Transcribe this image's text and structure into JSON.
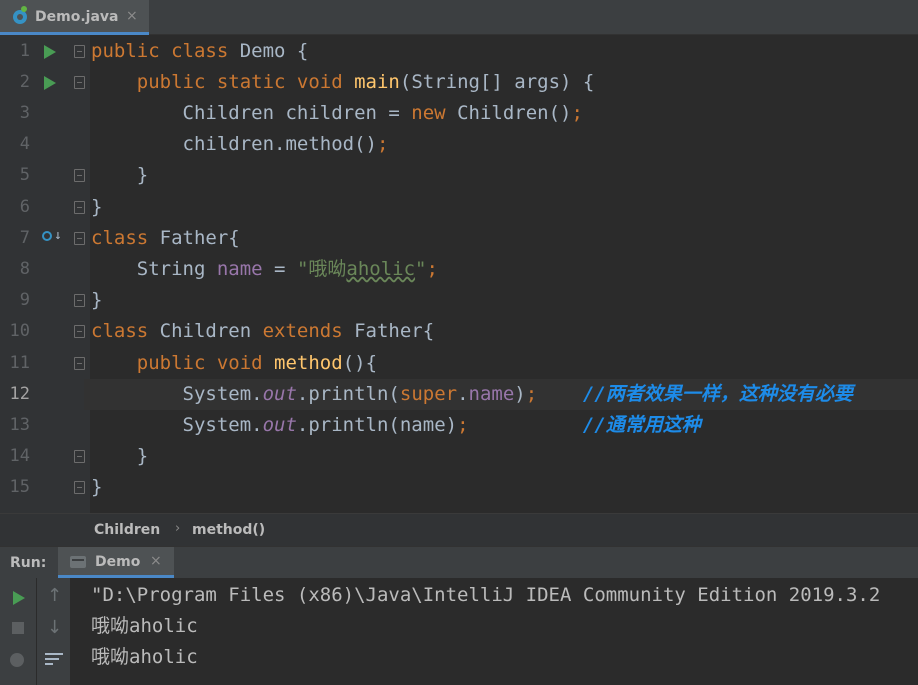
{
  "tab": {
    "label": "Demo.java",
    "close": "×",
    "icon": "java-class-icon"
  },
  "editor": {
    "caret_line": 12,
    "lines": [
      {
        "n": "1",
        "marker": "run",
        "fold": true,
        "tokens": [
          [
            "kw",
            "public "
          ],
          [
            "kw",
            "class "
          ],
          [
            "",
            "Demo {"
          ]
        ]
      },
      {
        "n": "2",
        "marker": "run",
        "fold": true,
        "tokens": [
          [
            "",
            "    "
          ],
          [
            "kw",
            "public static void "
          ],
          [
            "fn",
            "main"
          ],
          [
            "",
            "(String[] args) {"
          ]
        ]
      },
      {
        "n": "3",
        "marker": "",
        "fold": false,
        "tokens": [
          [
            "",
            "        Children children = "
          ],
          [
            "kw",
            "new "
          ],
          [
            "",
            "Children()"
          ],
          [
            "kw",
            ";"
          ]
        ]
      },
      {
        "n": "4",
        "marker": "",
        "fold": false,
        "tokens": [
          [
            "",
            "        children.method()"
          ],
          [
            "kw",
            ";"
          ]
        ]
      },
      {
        "n": "5",
        "marker": "",
        "fold": true,
        "tokens": [
          [
            "",
            "    }"
          ]
        ]
      },
      {
        "n": "6",
        "marker": "",
        "fold": true,
        "tokens": [
          [
            "",
            "}"
          ]
        ]
      },
      {
        "n": "7",
        "marker": "impl",
        "fold": true,
        "tokens": [
          [
            "kw",
            "class "
          ],
          [
            "",
            "Father{"
          ]
        ]
      },
      {
        "n": "8",
        "marker": "",
        "fold": false,
        "tokens": [
          [
            "",
            "    String "
          ],
          [
            "fld",
            "name"
          ],
          [
            "",
            " = "
          ],
          [
            "str",
            "\"哦呦"
          ],
          [
            "str typo",
            "aholic"
          ],
          [
            "str",
            "\""
          ],
          [
            "kw",
            ";"
          ]
        ]
      },
      {
        "n": "9",
        "marker": "",
        "fold": true,
        "tokens": [
          [
            "",
            "}"
          ]
        ]
      },
      {
        "n": "10",
        "marker": "",
        "fold": true,
        "tokens": [
          [
            "kw",
            "class "
          ],
          [
            "",
            "Children "
          ],
          [
            "kw",
            "extends "
          ],
          [
            "",
            "Father{"
          ]
        ]
      },
      {
        "n": "11",
        "marker": "",
        "fold": true,
        "tokens": [
          [
            "",
            "    "
          ],
          [
            "kw",
            "public void "
          ],
          [
            "fn",
            "method"
          ],
          [
            "",
            "(){"
          ]
        ]
      },
      {
        "n": "12",
        "marker": "",
        "fold": false,
        "tokens": [
          [
            "",
            "        System."
          ],
          [
            "sfld",
            "out"
          ],
          [
            "",
            ".println("
          ],
          [
            "kw",
            "super"
          ],
          [
            "",
            "."
          ],
          [
            "fld",
            "name"
          ],
          [
            "",
            ")"
          ],
          [
            "kw",
            ";"
          ],
          [
            "",
            "    "
          ],
          [
            "cmt",
            "//两者效果一样，这种没有必要"
          ]
        ]
      },
      {
        "n": "13",
        "marker": "",
        "fold": false,
        "tokens": [
          [
            "",
            "        System."
          ],
          [
            "sfld",
            "out"
          ],
          [
            "",
            ".println(name)"
          ],
          [
            "kw",
            ";"
          ],
          [
            "",
            "          "
          ],
          [
            "cmt",
            "//通常用这种"
          ]
        ]
      },
      {
        "n": "14",
        "marker": "",
        "fold": true,
        "tokens": [
          [
            "",
            "    }"
          ]
        ]
      },
      {
        "n": "15",
        "marker": "",
        "fold": true,
        "tokens": [
          [
            "",
            "}"
          ]
        ]
      }
    ]
  },
  "breadcrumb": {
    "items": [
      "Children",
      "method()"
    ],
    "separator": "›"
  },
  "run_panel": {
    "label": "Run:",
    "tab_label": "Demo",
    "tab_close": "×",
    "output": [
      "\"D:\\Program Files (x86)\\Java\\IntelliJ IDEA Community Edition 2019.3.2",
      "哦呦aholic",
      "哦呦aholic"
    ]
  },
  "colors": {
    "keyword": "#cc7832",
    "method": "#ffc66d",
    "field": "#9876aa",
    "string": "#6a8759",
    "comment": "#1d8be8",
    "text": "#a9b7c6",
    "run": "#499c54"
  }
}
